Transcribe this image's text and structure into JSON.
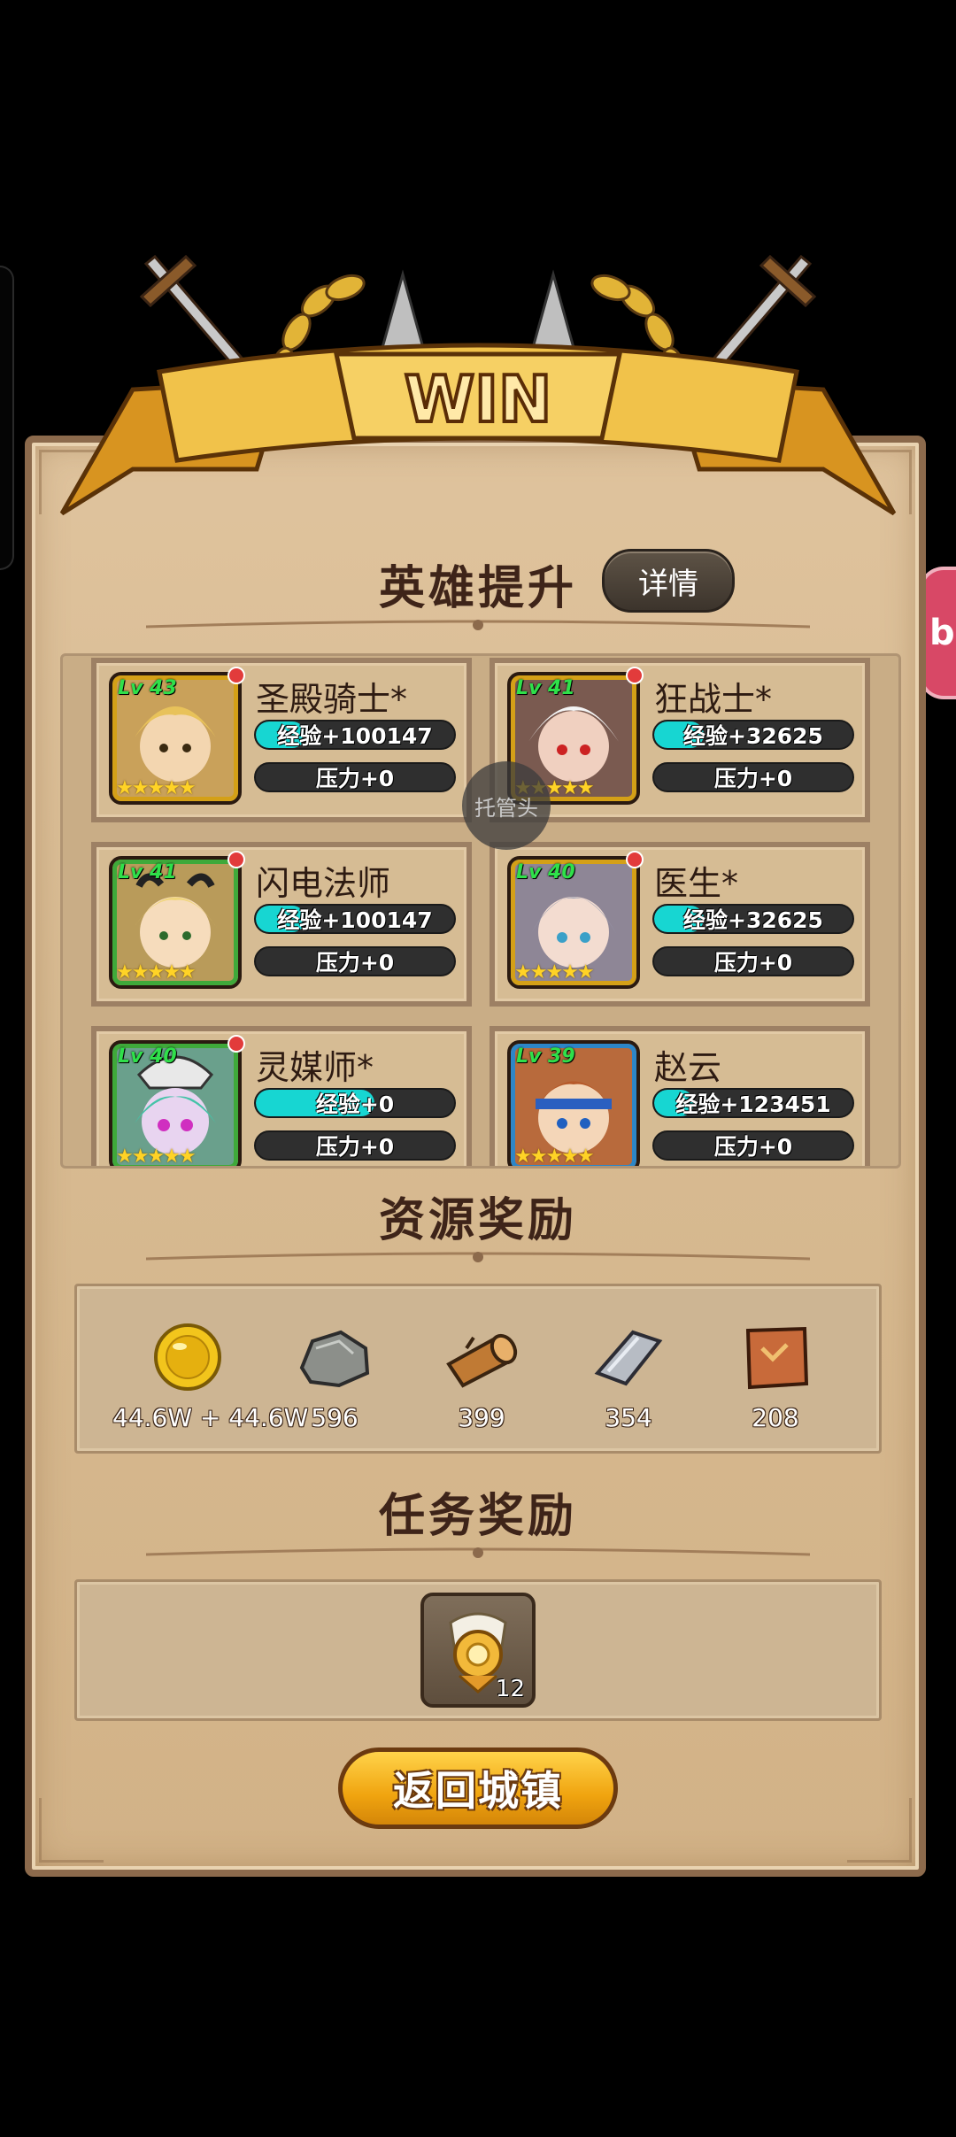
{
  "banner": {
    "title": "WIN"
  },
  "hero_section": {
    "title": "英雄提升",
    "details_label": "详情"
  },
  "heroes": [
    {
      "name": "圣殿骑士*",
      "level": "Lv 43",
      "exp": "经验+100147",
      "exp_fill": 0.25,
      "pressure": "压力+0",
      "stars": "★★★★★",
      "frame": "#d4a017",
      "bg": "#c9a15a"
    },
    {
      "name": "狂战士*",
      "level": "Lv 41",
      "exp": "经验+32625",
      "exp_fill": 0.25,
      "pressure": "压力+0",
      "stars": "★★★★★",
      "frame": "#d4a017",
      "bg": "#7a5a50"
    },
    {
      "name": "闪电法师",
      "level": "Lv 41",
      "exp": "经验+100147",
      "exp_fill": 0.25,
      "pressure": "压力+0",
      "stars": "★★★★★",
      "frame": "#3fa93a",
      "bg": "#b99b5a"
    },
    {
      "name": "医生*",
      "level": "Lv 40",
      "exp": "经验+32625",
      "exp_fill": 0.25,
      "pressure": "压力+0",
      "stars": "★★★★★",
      "frame": "#d4a017",
      "bg": "#8e8696"
    },
    {
      "name": "灵媒师*",
      "level": "Lv 40",
      "exp": "经验+0",
      "exp_fill": 0.6,
      "pressure": "压力+0",
      "stars": "★★★★★",
      "frame": "#3fa93a",
      "bg": "#6aa08c"
    },
    {
      "name": "赵云",
      "level": "Lv 39",
      "exp": "经验+123451",
      "exp_fill": 0.2,
      "pressure": "压力+0",
      "stars": "★★★★★",
      "frame": "#2d86c7",
      "bg": "#b86a3c"
    }
  ],
  "auto_bubble": "托管头",
  "resource_section": {
    "title": "资源奖励",
    "items": [
      {
        "icon": "gold-coin-icon",
        "value": "44.6W + 44.6W"
      },
      {
        "icon": "stone-icon",
        "value": "596"
      },
      {
        "icon": "wood-log-icon",
        "value": "399"
      },
      {
        "icon": "iron-ingot-icon",
        "value": "354"
      },
      {
        "icon": "leather-icon",
        "value": "208"
      }
    ]
  },
  "task_section": {
    "title": "任务奖励",
    "reward_icon": "medal-icon",
    "reward_count": "12"
  },
  "return_button": "返回城镇",
  "side_button_label": "b"
}
